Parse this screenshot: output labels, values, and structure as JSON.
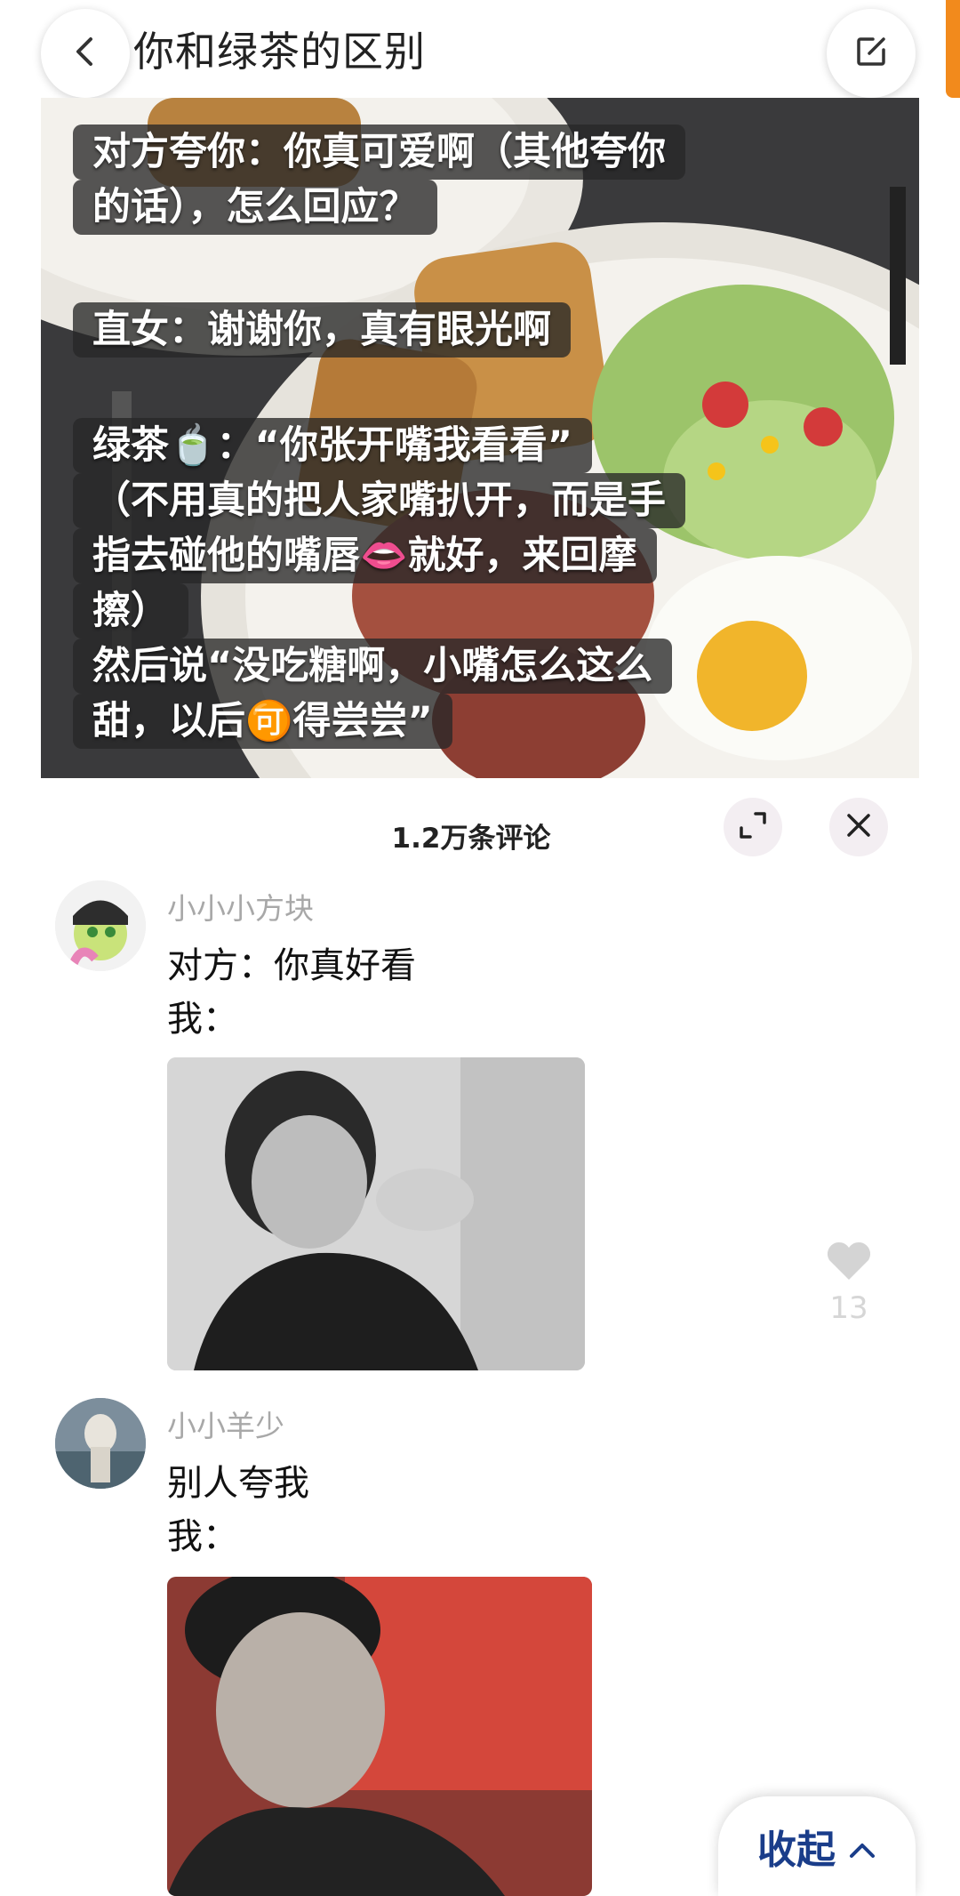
{
  "header": {
    "title": "你和绿茶的区别",
    "back_icon": "chevron-left-icon",
    "edit_icon": "share-edit-icon",
    "accent_color": "#f28a1c"
  },
  "post_image": {
    "lines": [
      "对方夸你：你真可爱啊（其他夸你",
      "的话），怎么回应？",
      "直女：谢谢你，真有眼光啊",
      "绿茶🍵：“你张开嘴我看看”",
      "（不用真的把人家嘴扒开，而是手",
      "指去碰他的嘴唇👄就好，来回摩",
      "擦）",
      "然后说“没吃糖啊，小嘴怎么这么",
      "甜，以后🉑得尝尝”"
    ]
  },
  "comments_sheet": {
    "title": "1.2万条评论",
    "expand_icon": "expand-icon",
    "close_icon": "close-icon",
    "comments": [
      {
        "username": "小小小方块",
        "line1": "对方：你真好看",
        "line2": "我：",
        "like_count": "13"
      },
      {
        "username": "小小羊少",
        "line1": "别人夸我",
        "line2": "我："
      }
    ],
    "collapse_label": "收起",
    "collapse_icon": "chevron-up-icon"
  }
}
